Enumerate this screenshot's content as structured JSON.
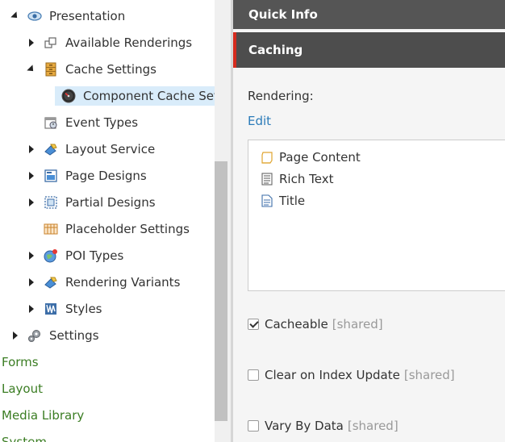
{
  "tree": {
    "presentation": "Presentation",
    "available_renderings": "Available Renderings",
    "cache_settings": "Cache Settings",
    "component_cache_settings": "Component Cache Setti",
    "event_types": "Event Types",
    "layout_service": "Layout Service",
    "page_designs": "Page Designs",
    "partial_designs": "Partial Designs",
    "placeholder_settings": "Placeholder Settings",
    "poi_types": "POI Types",
    "rendering_variants": "Rendering Variants",
    "styles": "Styles",
    "settings": "Settings",
    "forms": "Forms",
    "layout": "Layout",
    "media_library": "Media Library",
    "system": "System"
  },
  "content": {
    "quick_info": "Quick Info",
    "caching": "Caching",
    "rendering_label": "Rendering:",
    "edit_link": "Edit",
    "renderings": [
      "Page Content",
      "Rich Text",
      "Title"
    ],
    "cacheable": "Cacheable",
    "clear_on_index_update": "Clear on Index Update",
    "vary_by_data": "Vary By Data",
    "shared": "[shared]"
  },
  "colors": {
    "accent_red": "#d52b1e",
    "link_blue": "#2b7bb9",
    "tree_root_green": "#3b7d23",
    "selection": "#d9ecfa"
  }
}
